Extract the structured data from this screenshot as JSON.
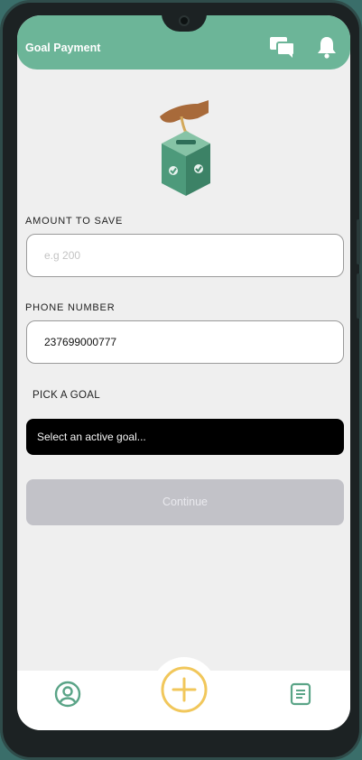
{
  "header": {
    "title": "Goal Payment",
    "icons": [
      "chat-bubbles-icon",
      "bell-icon"
    ],
    "color": "#6cb598"
  },
  "illustration": {
    "icon": "savings-box-with-coin-icon"
  },
  "form": {
    "amount": {
      "label": "AMOUNT TO SAVE",
      "placeholder": "e.g 200",
      "value": ""
    },
    "phone": {
      "label": "PHONE NUMBER",
      "value": "237699000777"
    },
    "goal": {
      "label": "PICK A GOAL",
      "selected": "Select an active goal..."
    },
    "continue_label": "Continue"
  },
  "bottom_nav": {
    "items": [
      "profile-icon",
      "add-icon",
      "document-icon"
    ],
    "accent": "#f1c75b"
  }
}
